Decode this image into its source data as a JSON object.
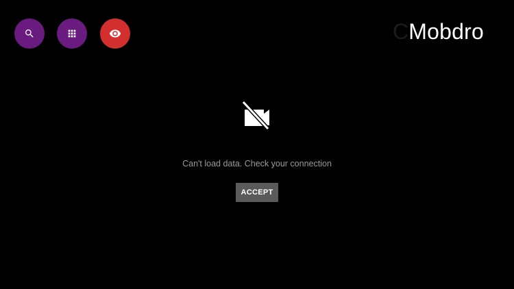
{
  "app": {
    "brand_prefix": "C",
    "brand_name": "Mobdro"
  },
  "toolbar": {
    "buttons": [
      {
        "icon": "search-icon",
        "color": "#6a1b7f"
      },
      {
        "icon": "apps-grid-icon",
        "color": "#6a1b7f"
      },
      {
        "icon": "eye-icon",
        "color": "#d32f2f"
      }
    ]
  },
  "error": {
    "icon": "video-off-icon",
    "message": "Can't load data. Check your connection",
    "button_label": "ACCEPT"
  }
}
